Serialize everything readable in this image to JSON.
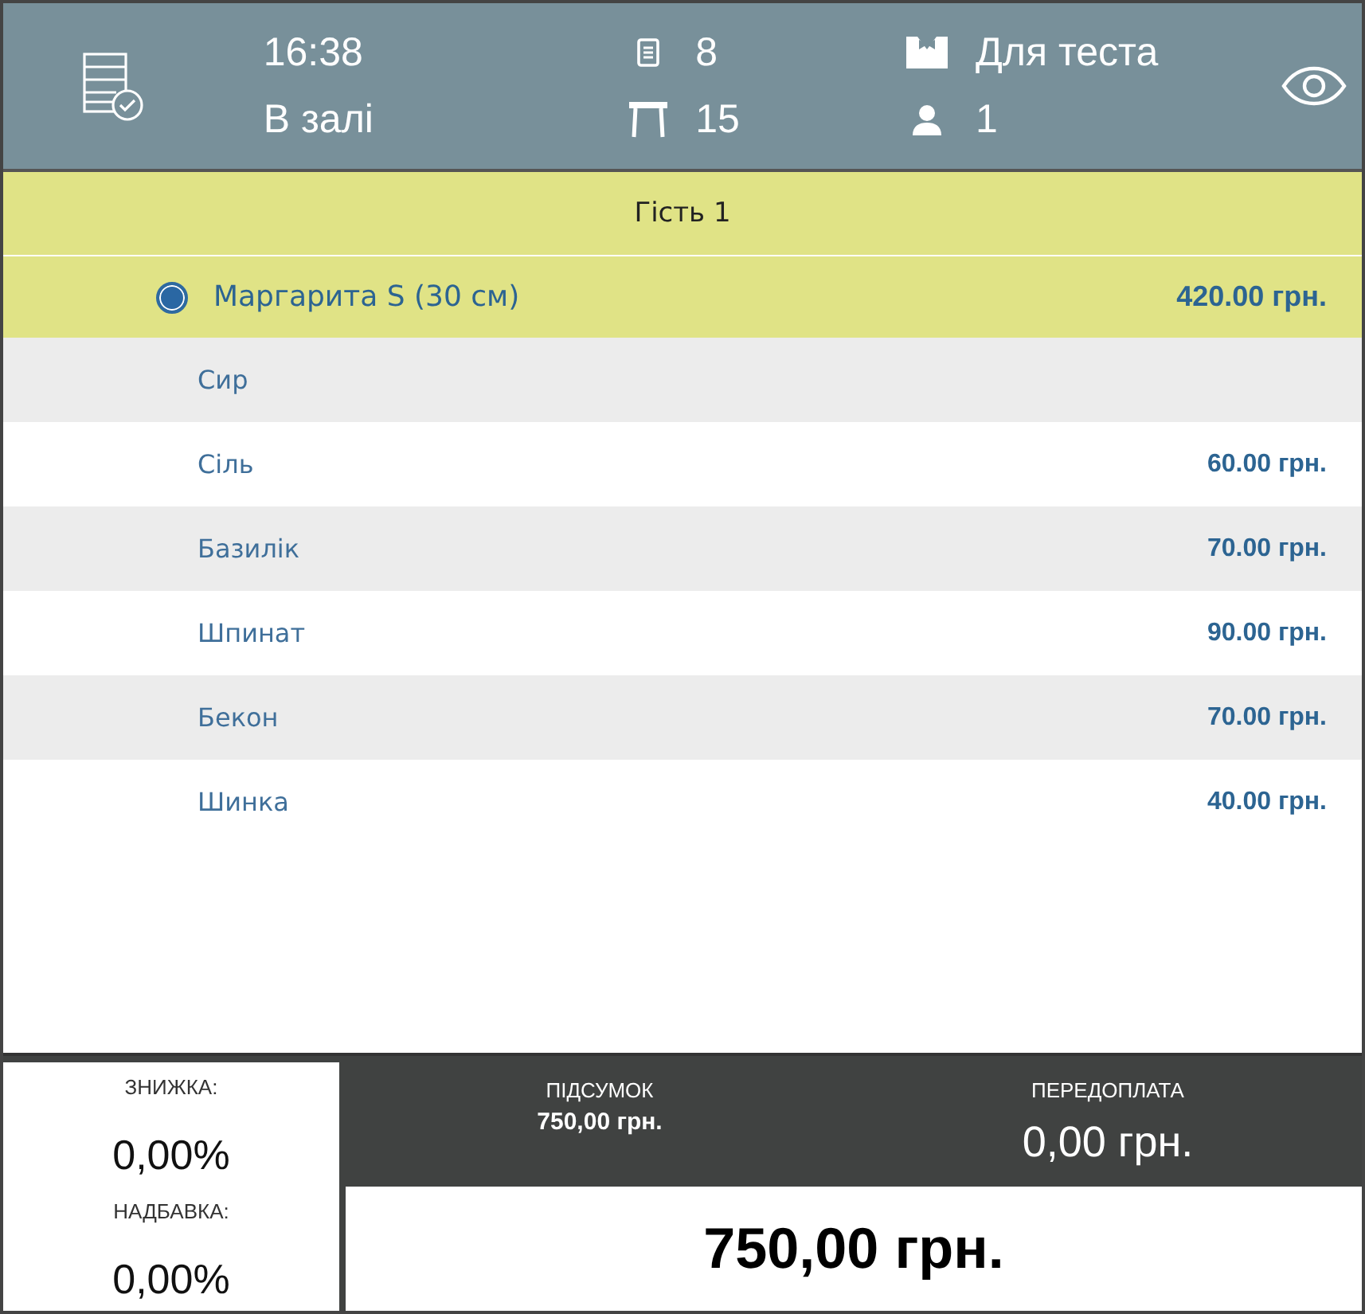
{
  "header": {
    "time": "16:38",
    "location": "В залі",
    "order_count": "8",
    "table": "15",
    "waiter": "Для теста",
    "guests": "1"
  },
  "guest": {
    "title": "Гість 1"
  },
  "item": {
    "name": "Маргарита S (30 см)",
    "price": "420.00 грн.",
    "selected": true
  },
  "modifiers": [
    {
      "name": "Сир"
    },
    {
      "name": "Сіль",
      "price": "60.00 грн."
    },
    {
      "name": "Базилік",
      "price": "70.00 грн."
    },
    {
      "name": "Шпинат",
      "price": "90.00 грн."
    },
    {
      "name": "Бекон",
      "price": "70.00 грн."
    },
    {
      "name": "Шинка",
      "price": "40.00 грн."
    }
  ],
  "summary": {
    "discount_label": "ЗНИЖКА:",
    "discount": "0,00%",
    "markup_label": "НАДБАВКА:",
    "markup": "0,00%",
    "subtotal_label": "ПІДСУМОК",
    "subtotal": "750,00 грн.",
    "prepay_label": "ПЕРЕДОПЛАТА",
    "prepay": "0,00 грн.",
    "total": "750,00 грн."
  }
}
